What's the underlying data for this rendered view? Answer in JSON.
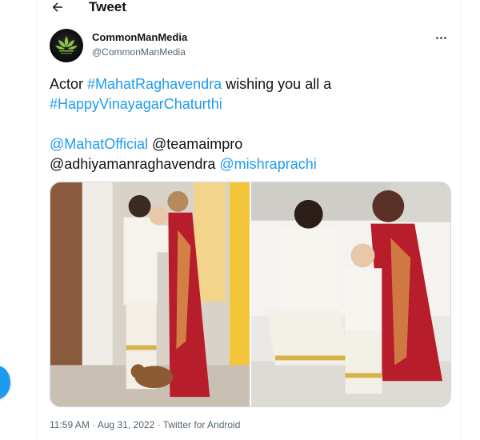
{
  "header": {
    "title": "Tweet"
  },
  "tweet": {
    "author": {
      "name": "CommonManMedia",
      "handle": "@CommonManMedia"
    },
    "text": {
      "line1_prefix": "Actor ",
      "hashtag1": "#MahatRaghavendra",
      "line1_suffix": " wishing you all a",
      "hashtag2": "#HappyVinayagarChaturthi",
      "mention1": "@MahatOfficial",
      "mention2_plain": " @teamaimpro",
      "mention3_plain": "@adhiyamanraghavendra ",
      "mention4": "@mishraprachi"
    },
    "media": [
      {
        "alt": "family photo 1"
      },
      {
        "alt": "family photo 2"
      }
    ],
    "meta": {
      "time": "11:59 AM",
      "separator": " · ",
      "date": "Aug 31, 2022",
      "client": "Twitter for Android"
    }
  },
  "colors": {
    "link": "#1d9bf0",
    "text": "#0f1419",
    "secondary": "#536471",
    "border": "#cfd9de"
  },
  "icons": {
    "back": "arrow-left-icon",
    "more": "more-horizontal-icon"
  }
}
